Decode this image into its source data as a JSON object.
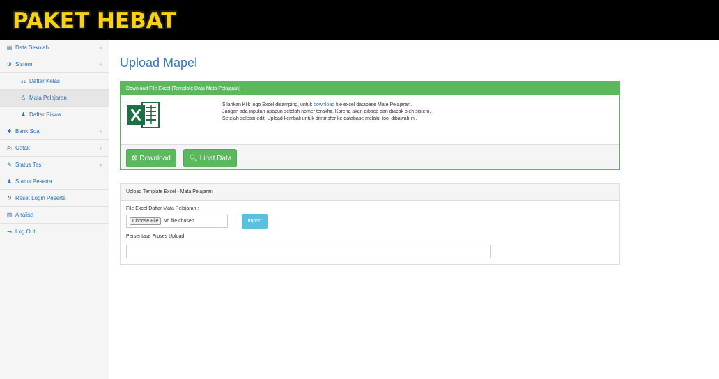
{
  "app": {
    "logo_text": "PAKET HEBAT"
  },
  "sidebar": {
    "items": [
      {
        "label": "Data Sekolah",
        "icon": "building-icon",
        "has_chevron": true
      },
      {
        "label": "Sistem",
        "icon": "cogs-icon",
        "has_chevron": true
      },
      {
        "label": "Daftar Kelas",
        "icon": "table-icon",
        "sub": true
      },
      {
        "label": "Mata Pelajaran",
        "icon": "user-icon",
        "sub": true,
        "active": true
      },
      {
        "label": "Daftar Siswa",
        "icon": "users-icon",
        "sub": true
      },
      {
        "label": "Bank Soal",
        "icon": "gear-icon",
        "has_chevron": true
      },
      {
        "label": "Cetak",
        "icon": "print-icon",
        "has_chevron": true
      },
      {
        "label": "Status Tes",
        "icon": "edit-icon",
        "has_chevron": true
      },
      {
        "label": "Status Peserta",
        "icon": "user-icon"
      },
      {
        "label": "Reset Login Peserta",
        "icon": "refresh-icon"
      },
      {
        "label": "Analisa",
        "icon": "chart-icon"
      },
      {
        "label": "Log Out",
        "icon": "logout-icon"
      }
    ]
  },
  "main": {
    "title": "Upload Mapel",
    "download_panel": {
      "header": "Download File Excel (Template Data Mata Pelajaran)",
      "line1_pre": "Silahkan Klik logo Excel disamping, untuk ",
      "line1_link": "download",
      "line1_post": " file excel database Mate Pelajaran.",
      "line2": "Jangan ada inputan apapun setelah nomer terakhir. Karena akan dibaca dan diacak oleh sistem.",
      "line3": "Setelah selesai edit, Upload kembali untuk ditransfer ke database melalui tool dibawah ini.",
      "download_label": "Download",
      "view_label": "Lihat Data"
    },
    "upload_panel": {
      "header": "Upload Template Excel - Mata Pelajaran",
      "file_label": "File Excel Daftar Mata Pelajaran :",
      "choose_file_label": "Choose File",
      "no_file_text": "No file chosen",
      "import_label": "Import",
      "progress_label": "Persentase Proses Upload",
      "progress_value": 0
    }
  },
  "colors": {
    "accent_green": "#5cb85c",
    "info_blue": "#5bc0de",
    "link_blue": "#2a6fb0",
    "logo_yellow": "#f7d117"
  }
}
